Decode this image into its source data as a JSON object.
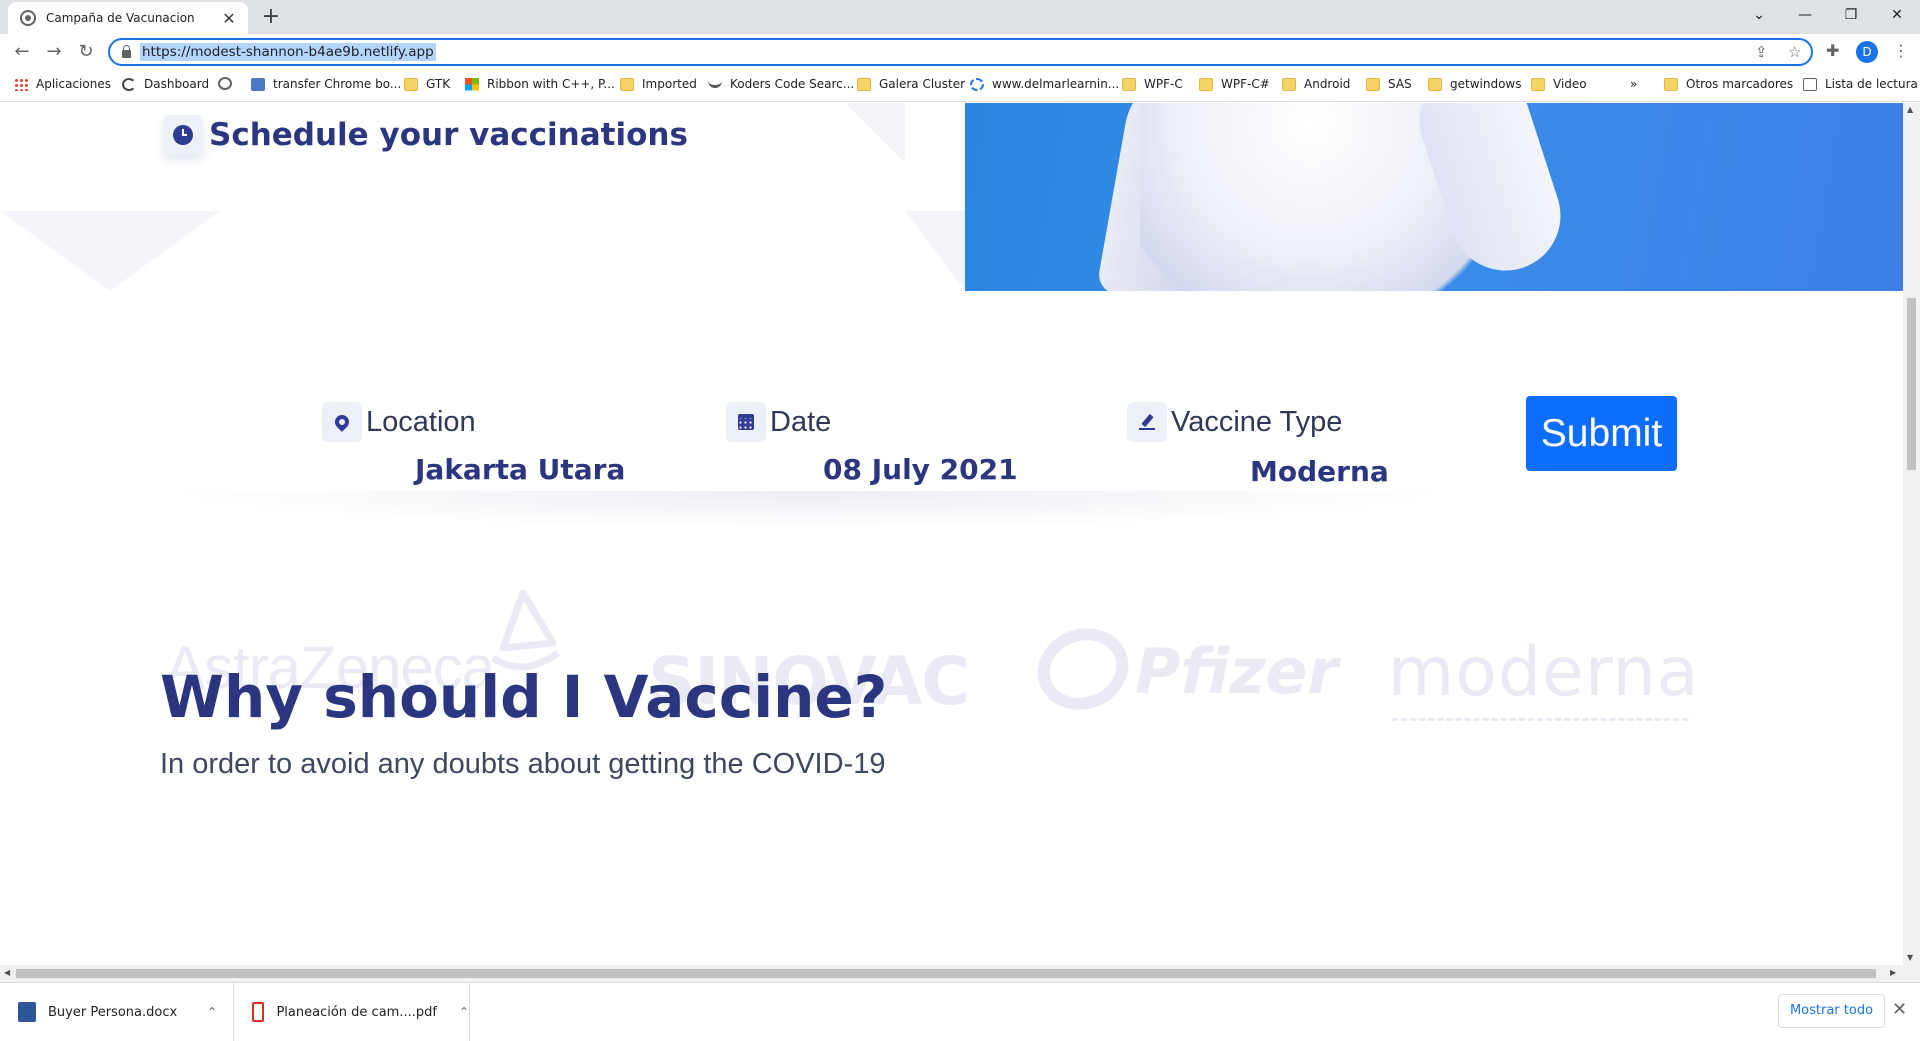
{
  "browser": {
    "tab_title": "Campaña de Vacunacion",
    "tab_close": "✕",
    "new_tab": "+",
    "url": "https://modest-shannon-b4ae9b.netlify.app",
    "profile_initial": "D",
    "window_controls": {
      "minimize": "—",
      "restore": "❐",
      "close": "✕",
      "tab_search": "⌄"
    },
    "nav": {
      "back": "←",
      "forward": "→",
      "reload": "↻"
    },
    "bookmarks": [
      {
        "label": "Aplicaciones",
        "icon": "apps-grid-icon"
      },
      {
        "label": "Dashboard",
        "icon": "dashboard-icon"
      },
      {
        "label": "",
        "icon": "globe-icon"
      },
      {
        "label": "transfer Chrome bo...",
        "icon": "bookmark-app-icon"
      },
      {
        "label": "GTK",
        "icon": "folder-icon"
      },
      {
        "label": "Ribbon with C++, P...",
        "icon": "microsoft-icon"
      },
      {
        "label": "Imported",
        "icon": "folder-icon"
      },
      {
        "label": "Koders Code Searc...",
        "icon": "koders-icon"
      },
      {
        "label": "Galera Cluster",
        "icon": "folder-icon"
      },
      {
        "label": "www.delmarlearnin...",
        "icon": "delmar-icon"
      },
      {
        "label": "WPF-C",
        "icon": "folder-icon"
      },
      {
        "label": "WPF-C#",
        "icon": "folder-icon"
      },
      {
        "label": "Android",
        "icon": "folder-icon"
      },
      {
        "label": "SAS",
        "icon": "folder-icon"
      },
      {
        "label": "getwindows",
        "icon": "folder-icon"
      },
      {
        "label": "Video",
        "icon": "folder-icon"
      }
    ],
    "more_bookmarks": "»",
    "other_bookmarks": "Otros marcadores",
    "reading_list": "Lista de lectura"
  },
  "page": {
    "schedule_title": "Schedule your vaccinations",
    "form": {
      "location": {
        "label": "Location",
        "value": "Jakarta Utara",
        "icon": "location-pin-icon"
      },
      "date": {
        "label": "Date",
        "value": "08 July 2021",
        "icon": "calendar-icon"
      },
      "vaccine": {
        "label": "Vaccine Type",
        "value": "Moderna",
        "icon": "pen-icon"
      },
      "submit_label": "Submit"
    },
    "brands": [
      "AstraZeneca",
      "SINOVAC",
      "Pfizer",
      "moderna"
    ],
    "why_heading": "Why should I Vaccine?",
    "why_text": "In order to avoid any doubts about getting the COVID-19"
  },
  "downloads": {
    "items": [
      {
        "name": "Buyer Persona.docx",
        "icon": "word-doc-icon"
      },
      {
        "name": "Planeación de cam....pdf",
        "icon": "pdf-icon"
      }
    ],
    "show_all": "Mostrar todo",
    "close": "✕"
  },
  "colors": {
    "accent": "#0d6efd",
    "heading": "#2b3580",
    "chrome_focus": "#1a73e8",
    "hero_blue": "#2a84e0"
  }
}
